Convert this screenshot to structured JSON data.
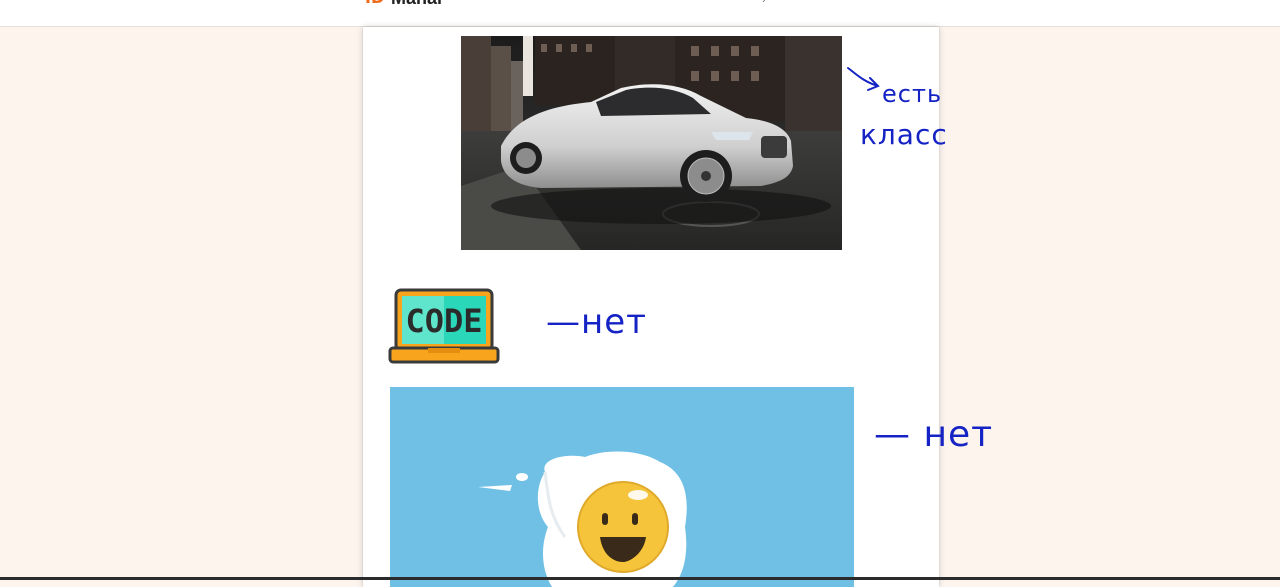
{
  "header": {
    "app_name": "Mahal",
    "logo_glyph": "ID",
    "nav_glyph": "›"
  },
  "images": {
    "car": {
      "alt": "silver coupe car on city street"
    },
    "code": {
      "label": "CODE"
    },
    "egg": {
      "alt": "smiling fried egg character on blue background"
    }
  },
  "annotations": {
    "car_note_line1": "есть",
    "car_note_line2": "класс",
    "code_note": "—нет",
    "egg_note": "— нет",
    "ink_color": "#1523c4"
  },
  "colors": {
    "page_background": "#fdf4ee",
    "sheet": "#ffffff",
    "brand_accent": "#f06a1c",
    "code_screen": "#2ad7b9",
    "code_base": "#f8a51d",
    "egg_background": "#70c0e6"
  }
}
